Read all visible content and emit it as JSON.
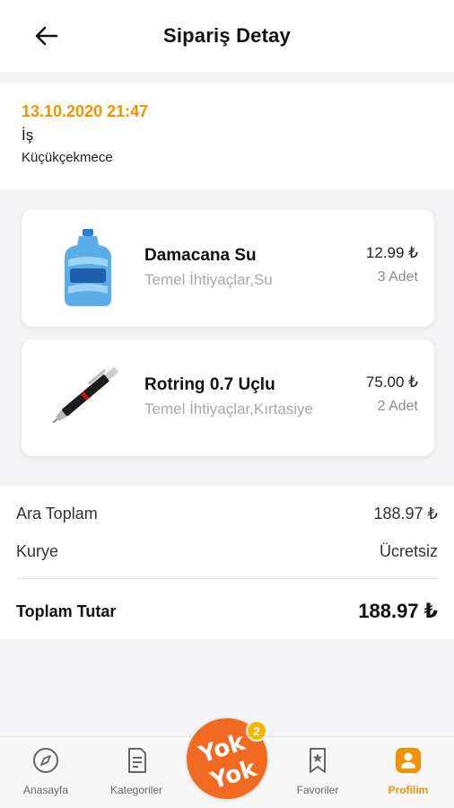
{
  "header": {
    "title": "Sipariş Detay"
  },
  "order": {
    "date": "13.10.2020 21:47",
    "address_name": "İş",
    "location": "Küçükçekmece"
  },
  "items": [
    {
      "name": "Damacana Su",
      "category": "Temel İhtiyaçlar,Su",
      "price": "12.99 ₺",
      "quantity": "3 Adet",
      "image_icon": "water-bottle-image"
    },
    {
      "name": "Rotring 0.7 Uçlu",
      "category": "Temel İhtiyaçlar,Kırtasiye",
      "price": "75.00 ₺",
      "quantity": "2 Adet",
      "image_icon": "mechanical-pencil-image"
    }
  ],
  "totals": {
    "subtotal_label": "Ara Toplam",
    "subtotal_value": "188.97 ₺",
    "courier_label": "Kurye",
    "courier_value": "Ücretsiz",
    "total_label": "Toplam Tutar",
    "total_value": "188.97 ₺"
  },
  "tabbar": {
    "tabs": [
      {
        "label": "Anasayfa",
        "icon": "compass-icon"
      },
      {
        "label": "Kategoriler",
        "icon": "document-list-icon"
      },
      {
        "label": "Favoriler",
        "icon": "bookmark-star-icon"
      },
      {
        "label": "Profilim",
        "icon": "profile-icon",
        "active": true
      }
    ],
    "logo_text_1": "Yok",
    "logo_text_2": "Yok",
    "badge_count": "2"
  },
  "colors": {
    "accent": "#f39200",
    "logo": "#f26a21",
    "badge": "#f7b500"
  }
}
